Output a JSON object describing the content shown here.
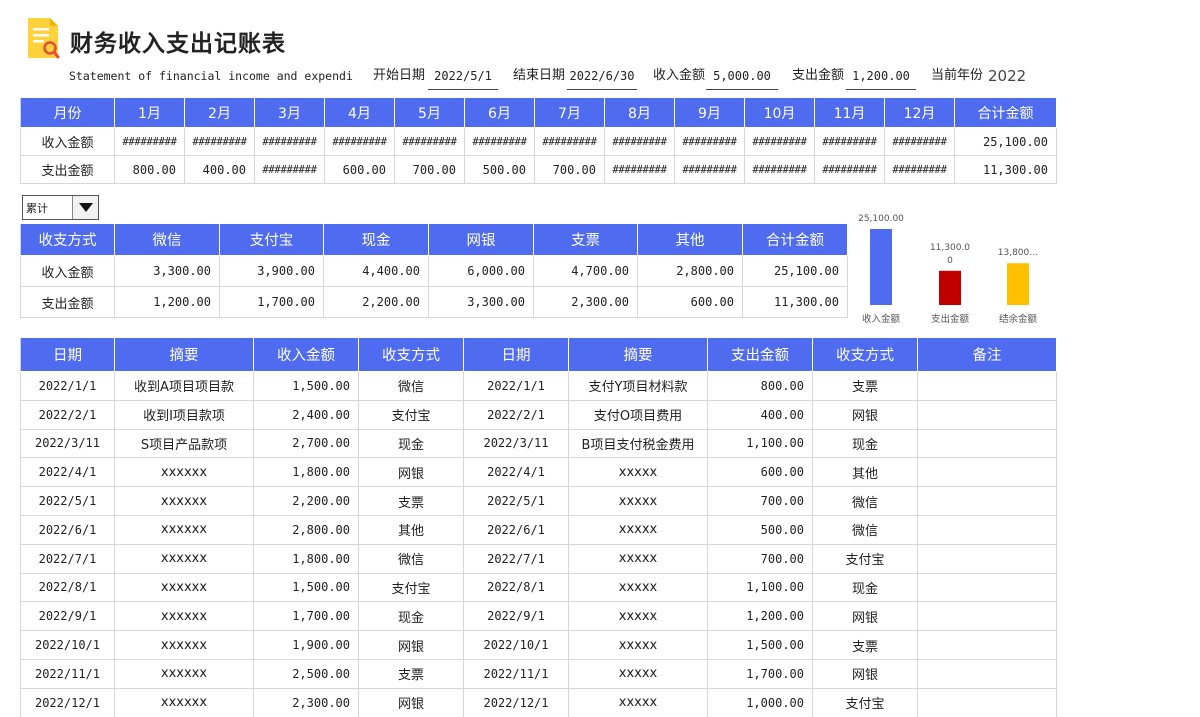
{
  "header": {
    "title": "财务收入支出记账表",
    "subtitle": "Statement of financial income and expendi",
    "start_label": "开始日期",
    "start_value": "2022/5/1",
    "end_label": "结束日期",
    "end_value": "2022/6/30",
    "income_label": "收入金额",
    "income_value": "5,000.00",
    "expense_label": "支出金额",
    "expense_value": "1,200.00",
    "year_label": "当前年份",
    "year_value": "2022"
  },
  "monthly": {
    "headers": [
      "月份",
      "1月",
      "2月",
      "3月",
      "4月",
      "5月",
      "6月",
      "7月",
      "8月",
      "9月",
      "10月",
      "11月",
      "12月",
      "合计金额"
    ],
    "rows": [
      [
        "收入金额",
        "#########",
        "#########",
        "#########",
        "#########",
        "#########",
        "#########",
        "#########",
        "#########",
        "#########",
        "#########",
        "#########",
        "#########",
        "25,100.00"
      ],
      [
        "支出金额",
        "800.00",
        "400.00",
        "#########",
        "600.00",
        "700.00",
        "500.00",
        "700.00",
        "#########",
        "#########",
        "#########",
        "#########",
        "#########",
        "11,300.00"
      ]
    ]
  },
  "filter": {
    "selected": "累计"
  },
  "methods": {
    "headers": [
      "收支方式",
      "微信",
      "支付宝",
      "现金",
      "网银",
      "支票",
      "其他",
      "合计金额"
    ],
    "rows": [
      [
        "收入金额",
        "3,300.00",
        "3,900.00",
        "4,400.00",
        "6,000.00",
        "4,700.00",
        "2,800.00",
        "25,100.00"
      ],
      [
        "支出金额",
        "1,200.00",
        "1,700.00",
        "2,200.00",
        "3,300.00",
        "2,300.00",
        "600.00",
        "11,300.00"
      ]
    ]
  },
  "chart_data": {
    "type": "bar",
    "categories": [
      "收入金额",
      "支出金额",
      "结余金额"
    ],
    "values": [
      25100,
      11300,
      13800
    ],
    "data_labels": [
      "25,100.00",
      "11,300.0\n0",
      "13,800…"
    ],
    "colors": [
      "#4f6bef",
      "#c00000",
      "#ffc000"
    ],
    "ylim": [
      0,
      25100
    ],
    "title": "",
    "xlabel": "",
    "ylabel": ""
  },
  "ledger": {
    "headers": [
      "日期",
      "摘要",
      "收入金额",
      "收支方式",
      "日期",
      "摘要",
      "支出金额",
      "收支方式",
      "备注"
    ],
    "rows": [
      [
        "2022/1/1",
        "收到A项目项目款",
        "1,500.00",
        "微信",
        "2022/1/1",
        "支付Y项目材料款",
        "800.00",
        "支票",
        ""
      ],
      [
        "2022/2/1",
        "收到I项目款项",
        "2,400.00",
        "支付宝",
        "2022/2/1",
        "支付O项目费用",
        "400.00",
        "网银",
        ""
      ],
      [
        "2022/3/11",
        "S项目产品款项",
        "2,700.00",
        "现金",
        "2022/3/11",
        "B项目支付税金费用",
        "1,100.00",
        "现金",
        ""
      ],
      [
        "2022/4/1",
        "xxxxxx",
        "1,800.00",
        "网银",
        "2022/4/1",
        "xxxxx",
        "600.00",
        "其他",
        ""
      ],
      [
        "2022/5/1",
        "xxxxxx",
        "2,200.00",
        "支票",
        "2022/5/1",
        "xxxxx",
        "700.00",
        "微信",
        ""
      ],
      [
        "2022/6/1",
        "xxxxxx",
        "2,800.00",
        "其他",
        "2022/6/1",
        "xxxxx",
        "500.00",
        "微信",
        ""
      ],
      [
        "2022/7/1",
        "xxxxxx",
        "1,800.00",
        "微信",
        "2022/7/1",
        "xxxxx",
        "700.00",
        "支付宝",
        ""
      ],
      [
        "2022/8/1",
        "xxxxxx",
        "1,500.00",
        "支付宝",
        "2022/8/1",
        "xxxxx",
        "1,100.00",
        "现金",
        ""
      ],
      [
        "2022/9/1",
        "xxxxxx",
        "1,700.00",
        "现金",
        "2022/9/1",
        "xxxxx",
        "1,200.00",
        "网银",
        ""
      ],
      [
        "2022/10/1",
        "xxxxxx",
        "1,900.00",
        "网银",
        "2022/10/1",
        "xxxxx",
        "1,500.00",
        "支票",
        ""
      ],
      [
        "2022/11/1",
        "xxxxxx",
        "2,500.00",
        "支票",
        "2022/11/1",
        "xxxxx",
        "1,700.00",
        "网银",
        ""
      ],
      [
        "2022/12/1",
        "xxxxxx",
        "2,300.00",
        "网银",
        "2022/12/1",
        "xxxxx",
        "1,000.00",
        "支付宝",
        ""
      ]
    ]
  }
}
